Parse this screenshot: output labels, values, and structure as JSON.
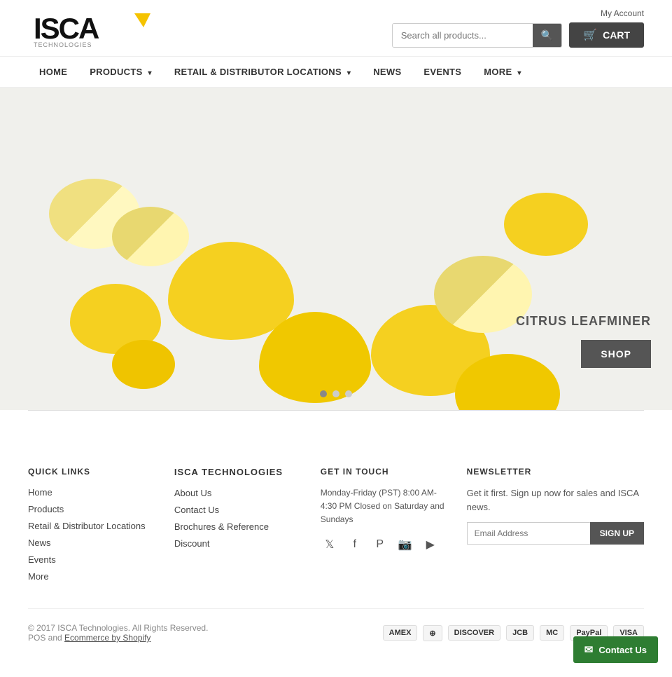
{
  "header": {
    "my_account_label": "My Account",
    "search_placeholder": "Search all products...",
    "cart_label": "CART",
    "search_button_label": "🔍"
  },
  "logo": {
    "text": "ISCA",
    "tagline": ""
  },
  "nav": {
    "items": [
      {
        "label": "HOME",
        "href": "#",
        "has_dropdown": false
      },
      {
        "label": "PRODUCTS",
        "href": "#",
        "has_dropdown": true
      },
      {
        "label": "RETAIL & DISTRIBUTOR LOCATIONS",
        "href": "#",
        "has_dropdown": true
      },
      {
        "label": "NEWS",
        "href": "#",
        "has_dropdown": false
      },
      {
        "label": "EVENTS",
        "href": "#",
        "has_dropdown": false
      },
      {
        "label": "MORE",
        "href": "#",
        "has_dropdown": true
      }
    ]
  },
  "hero": {
    "title": "CITRUS LEAFMINER",
    "shop_button": "SHOP",
    "dots": [
      {
        "active": true
      },
      {
        "active": false
      },
      {
        "active": false
      }
    ]
  },
  "footer": {
    "quick_links_title": "QUICK LINKS",
    "quick_links": [
      {
        "label": "Home"
      },
      {
        "label": "Products"
      },
      {
        "label": "Retail & Distributor Locations"
      },
      {
        "label": "News"
      },
      {
        "label": "Events"
      },
      {
        "label": "More"
      }
    ],
    "isca_title": "ISCA TECHNOLOGIES",
    "isca_links": [
      {
        "label": "About Us"
      },
      {
        "label": "Contact Us"
      },
      {
        "label": "Brochures & Reference"
      },
      {
        "label": "Discount"
      }
    ],
    "get_in_touch_title": "GET IN TOUCH",
    "get_in_touch_hours": "Monday-Friday (PST) 8:00 AM- 4:30 PM Closed on Saturday and Sundays",
    "social_icons": [
      {
        "name": "twitter",
        "symbol": "𝕏"
      },
      {
        "name": "facebook",
        "symbol": "f"
      },
      {
        "name": "pinterest",
        "symbol": "P"
      },
      {
        "name": "instagram",
        "symbol": "📷"
      },
      {
        "name": "youtube",
        "symbol": "▶"
      }
    ],
    "newsletter_title": "NEWSLETTER",
    "newsletter_desc": "Get it first. Sign up now for sales and ISCA news.",
    "newsletter_placeholder": "Email Address",
    "newsletter_button": "SIGN UP",
    "copyright": "© 2017 ISCA Technologies. All Rights Reserved.",
    "pos_text": "POS and",
    "ecommerce_text": "Ecommerce by Shopify",
    "payment_icons": [
      "AMEX",
      "DINERS",
      "DISCOVER",
      "JCB",
      "MASTER",
      "PAYPAL",
      "VISA"
    ],
    "contact_float_label": "Contact Us"
  }
}
